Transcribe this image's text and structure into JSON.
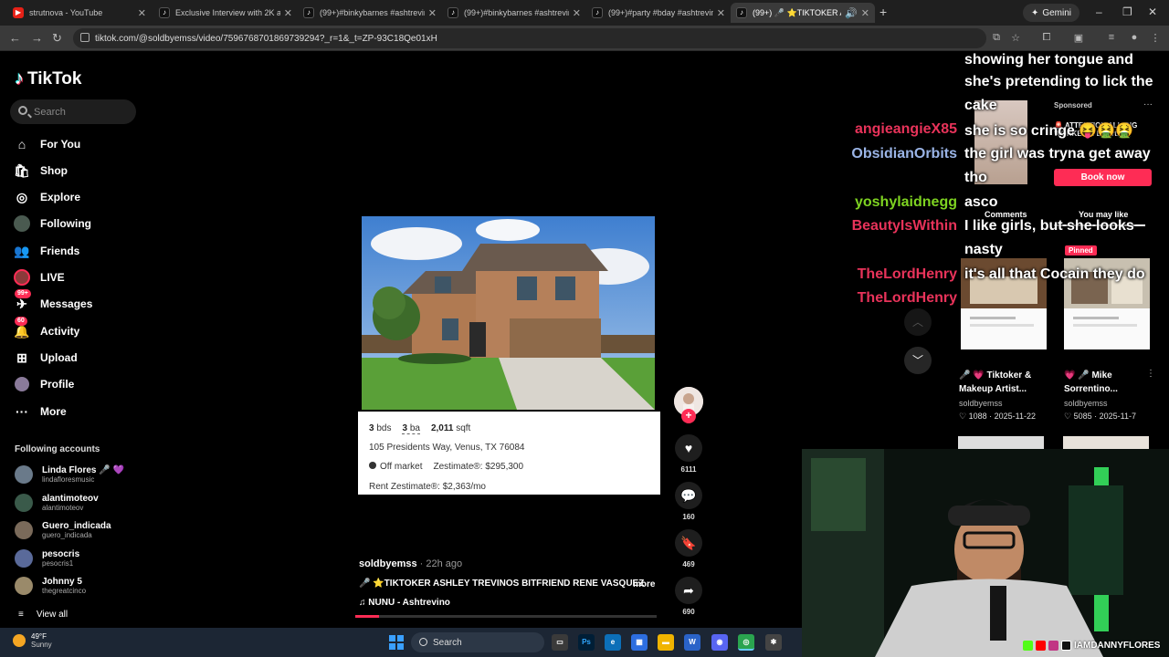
{
  "browser": {
    "tabs": [
      {
        "title": "strutnova - YouTube",
        "favicon": "youtube-icon"
      },
      {
        "title": "Exclusive Interview with 2K at T",
        "favicon": "tiktok-icon"
      },
      {
        "title": "(99+)#binkybarnes #ashtrevin",
        "favicon": "tiktok-icon"
      },
      {
        "title": "(99+)#binkybarnes #ashtrevin",
        "favicon": "tiktok-icon"
      },
      {
        "title": "(99+)#party #bday #ashtrevino",
        "favicon": "tiktok-icon"
      },
      {
        "title": "(99+) 🎤 ⭐TIKTOKER ASHL",
        "favicon": "tiktok-icon"
      }
    ],
    "gemini_label": "Gemini",
    "url": "tiktok.com/@soldbyemss/video/7596768701869739294?_r=1&_t=ZP-93C18Qe01xH"
  },
  "tiktok": {
    "logo": "TikTok",
    "search_placeholder": "Search",
    "nav": [
      {
        "label": "For You",
        "icon": "home-icon"
      },
      {
        "label": "Shop",
        "icon": "shop-bag-icon"
      },
      {
        "label": "Explore",
        "icon": "compass-icon"
      },
      {
        "label": "Following",
        "icon": "avatar-icon"
      },
      {
        "label": "Friends",
        "icon": "friends-icon"
      },
      {
        "label": "LIVE",
        "icon": "live-avatar-icon"
      },
      {
        "label": "Messages",
        "icon": "message-icon",
        "badge": "99+"
      },
      {
        "label": "Activity",
        "icon": "bell-icon",
        "badge": "60"
      },
      {
        "label": "Upload",
        "icon": "plus-square-icon"
      },
      {
        "label": "Profile",
        "icon": "profile-icon"
      },
      {
        "label": "More",
        "icon": "ellipsis-icon"
      }
    ],
    "following_header": "Following accounts",
    "following": [
      {
        "name": "Linda Flores 🎤 💜",
        "handle": "lindafloresmusic"
      },
      {
        "name": "alantimoteov",
        "handle": "alantimoteov"
      },
      {
        "name": "Guero_indicada",
        "handle": "guero_indicada"
      },
      {
        "name": "pesocris",
        "handle": "pesocris1"
      },
      {
        "name": "Johnny 5",
        "handle": "thegreatcinco"
      }
    ],
    "view_all": "View all"
  },
  "listing": {
    "beds": "3",
    "beds_unit": "bds",
    "baths": "3",
    "baths_unit": "ba",
    "sqft": "2,011",
    "sqft_unit": "sqft",
    "address": "105 Presidents Way, Venus, TX 76084",
    "status": "Off market",
    "zestimate": "Zestimate®: $295,300",
    "rent_zestimate": "Rent Zestimate®: $2,363/mo"
  },
  "video": {
    "author": "soldbyemss",
    "age": " · 22h ago",
    "caption": "🎤 ⭐TIKTOKER ASHLEY TREVINOS BITFRIEND RENE VASQUEZ",
    "more": "more",
    "music": "♫  NUNU - Ashtrevino",
    "progress": 0.08,
    "likes": "6111",
    "comments": "160",
    "saves": "469",
    "shares": "690"
  },
  "chat": {
    "names": [
      {
        "name": "angieangieX85",
        "color": "#e8335a"
      },
      {
        "name": "ObsidianOrbits",
        "color": "#9ab4e6"
      },
      {
        "name": "yoshylaidnegg",
        "color": "#7ed321"
      },
      {
        "name": "BeautyIsWithin",
        "color": "#e8335a"
      },
      {
        "name": "TheLordHenry",
        "color": "#e8335a"
      },
      {
        "name": "TheLordHenry",
        "color": "#e8335a"
      }
    ],
    "messages": [
      "showing her tongue and",
      "she's pretending to lick the",
      "cake",
      "she is so cringe 😝🤮🤮",
      "the girl was tryna get away",
      "tho",
      "asco",
      "I like girls, but she looks",
      "nasty",
      "it's all that Cocain they do"
    ]
  },
  "right_panel": {
    "sponsored_label": "Sponsored",
    "sponsored_title": "🚨 ATTENTION ALL GIG WORKERS! Libert...",
    "book_now": "Book now",
    "tab_comments": "Comments",
    "tab_may_like": "You may like",
    "pinned": "Pinned",
    "recs": [
      {
        "title": "🎤 💗 Tiktoker & Makeup Artist...",
        "user": "soldbyemss",
        "likes": "♡ 1088",
        "date": "2025-11-22"
      },
      {
        "title": "💗 🎤 Mike Sorrentino...",
        "user": "soldbyemss",
        "likes": "♡ 5085",
        "date": "2025-11-7"
      }
    ]
  },
  "stream": {
    "handle": "IAMDANNYFLORES"
  },
  "taskbar": {
    "temp": "49°F",
    "condition": "Sunny",
    "search": "Search"
  }
}
